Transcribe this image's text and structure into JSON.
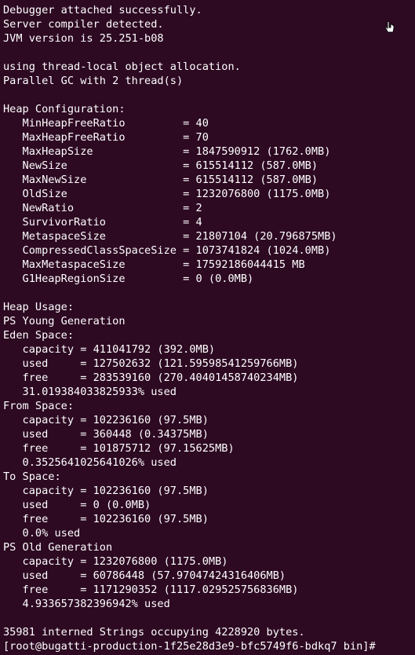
{
  "terminal": {
    "lines": [
      "Debugger attached successfully.",
      "Server compiler detected.",
      "JVM version is 25.251-b08",
      "",
      "using thread-local object allocation.",
      "Parallel GC with 2 thread(s)",
      "",
      "Heap Configuration:",
      "   MinHeapFreeRatio         = 40",
      "   MaxHeapFreeRatio         = 70",
      "   MaxHeapSize              = 1847590912 (1762.0MB)",
      "   NewSize                  = 615514112 (587.0MB)",
      "   MaxNewSize               = 615514112 (587.0MB)",
      "   OldSize                  = 1232076800 (1175.0MB)",
      "   NewRatio                 = 2",
      "   SurvivorRatio            = 4",
      "   MetaspaceSize            = 21807104 (20.796875MB)",
      "   CompressedClassSpaceSize = 1073741824 (1024.0MB)",
      "   MaxMetaspaceSize         = 17592186044415 MB",
      "   G1HeapRegionSize         = 0 (0.0MB)",
      "",
      "Heap Usage:",
      "PS Young Generation",
      "Eden Space:",
      "   capacity = 411041792 (392.0MB)",
      "   used     = 127502632 (121.59598541259766MB)",
      "   free     = 283539160 (270.40401458740234MB)",
      "   31.019384033825933% used",
      "From Space:",
      "   capacity = 102236160 (97.5MB)",
      "   used     = 360448 (0.34375MB)",
      "   free     = 101875712 (97.15625MB)",
      "   0.3525641025641026% used",
      "To Space:",
      "   capacity = 102236160 (97.5MB)",
      "   used     = 0 (0.0MB)",
      "   free     = 102236160 (97.5MB)",
      "   0.0% used",
      "PS Old Generation",
      "   capacity = 1232076800 (1175.0MB)",
      "   used     = 60786448 (57.97047424316406MB)",
      "   free     = 1171290352 (1117.029525756836MB)",
      "   4.933657382396942% used",
      "",
      "35981 interned Strings occupying 4228920 bytes.",
      "[root@bugatti-production-1f25e28d3e9-bfc5749f6-bdkq7 bin]#"
    ],
    "background_color": "#2d0922",
    "text_color": "#ffffff",
    "mouse_pointer_icon": "hand-pointer-icon"
  }
}
